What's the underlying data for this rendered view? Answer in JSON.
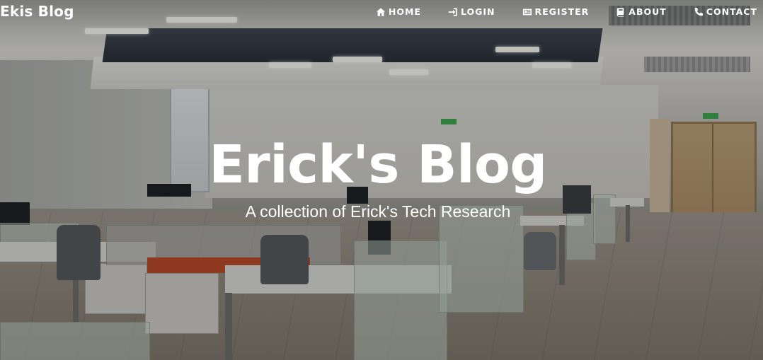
{
  "brand": "Ekis Blog",
  "nav": {
    "items": [
      {
        "label": "HOME",
        "icon": "home-icon"
      },
      {
        "label": "LOGIN",
        "icon": "sign-in-icon"
      },
      {
        "label": "REGISTER",
        "icon": "id-card-icon"
      },
      {
        "label": "ABOUT",
        "icon": "book-icon"
      },
      {
        "label": "CONTACT",
        "icon": "phone-icon"
      }
    ]
  },
  "hero": {
    "title": "Erick's Blog",
    "subtitle": "A collection of Erick's Tech Research",
    "background": "office-interior-photo"
  },
  "colors": {
    "text": "#ffffff",
    "overlay": "#000000"
  }
}
